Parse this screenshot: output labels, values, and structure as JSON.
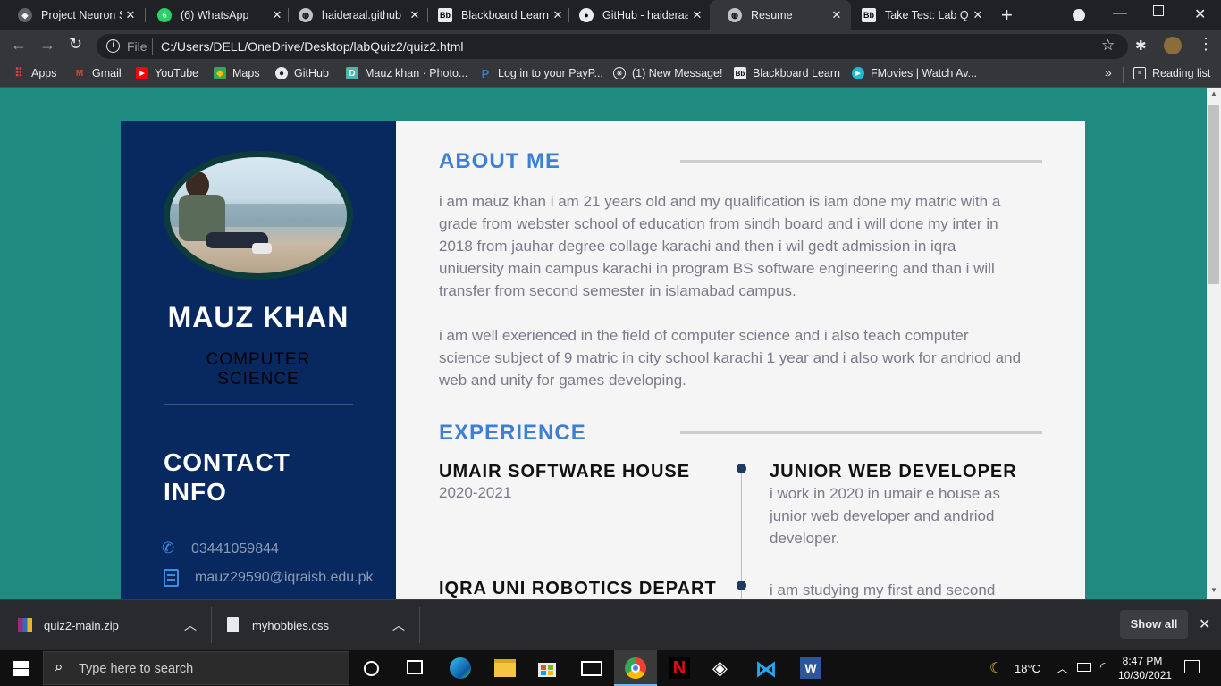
{
  "browser": {
    "tabs": [
      {
        "title": "Project Neuron S"
      },
      {
        "title": "(6) WhatsApp"
      },
      {
        "title": "haideraal.github"
      },
      {
        "title": "Blackboard Learn"
      },
      {
        "title": "GitHub - haideraal"
      },
      {
        "title": "Resume"
      },
      {
        "title": "Take Test: Lab Qui"
      }
    ],
    "address": {
      "scheme_label": "File",
      "url": "C:/Users/DELL/OneDrive/Desktop/labQuiz2/quiz2.html"
    },
    "bookmarks": [
      {
        "label": "Apps"
      },
      {
        "label": "Gmail"
      },
      {
        "label": "YouTube"
      },
      {
        "label": "Maps"
      },
      {
        "label": "GitHub"
      },
      {
        "label": "Mauz khan · Photo..."
      },
      {
        "label": "Log in to your PayP..."
      },
      {
        "label": "(1) New Message!"
      },
      {
        "label": "Blackboard Learn"
      },
      {
        "label": "FMovies | Watch Av..."
      }
    ],
    "bookmarks_more": "»",
    "reading_list": "Reading list"
  },
  "resume": {
    "name": "MAUZ KHAN",
    "role_line1": "COMPUTER",
    "role_line2": "SCIENCE",
    "contact_title_line1": "CONTACT",
    "contact_title_line2": "INFO",
    "phone": "03441059844",
    "email": "mauz29590@iqraisb.edu.pk",
    "about_title": "ABOUT ME",
    "about_p1_lines": [
      "i am mauz khan i am 21 years old and my qualification is iam done my matric with a",
      "grade from webster school of education from sindh board and i will done my inter in",
      "2018 from jauhar degree collage karachi and then i wil gedt admission in iqra",
      "uniuersity main campus karachi in program BS software engineering and than i will",
      "transfer from second semester in islamabad campus."
    ],
    "about_p2_lines": [
      "i am well exerienced in the field of computer science and i also teach computer",
      "science subject of 9 matric in city school karachi 1 year and i also work for andriod and",
      "web and unity for games developing."
    ],
    "experience_title": "EXPERIENCE",
    "experience": [
      {
        "company": "UMAIR SOFTWARE HOUSE",
        "years": "2020-2021",
        "position": "JUNIOR WEB DEVELOPER",
        "desc_lines": [
          "i work in 2020 in umair e house as",
          "junior web developer and andriod",
          "developer."
        ]
      },
      {
        "company": "IQRA UNI ROBOTICS DEPART",
        "desc_lines": [
          "i am studying my first and second"
        ]
      }
    ]
  },
  "downloads": {
    "items": [
      {
        "name": "quiz2-main.zip"
      },
      {
        "name": "myhobbies.css"
      }
    ],
    "show_all": "Show all"
  },
  "taskbar": {
    "search_placeholder": "Type here to search",
    "weather": "18°C",
    "time": "8:47 PM",
    "date": "10/30/2021"
  },
  "colors": {
    "page_bg": "#1f8a80",
    "sidebar_bg": "#082860",
    "accent_blue": "#3d7fd6"
  }
}
